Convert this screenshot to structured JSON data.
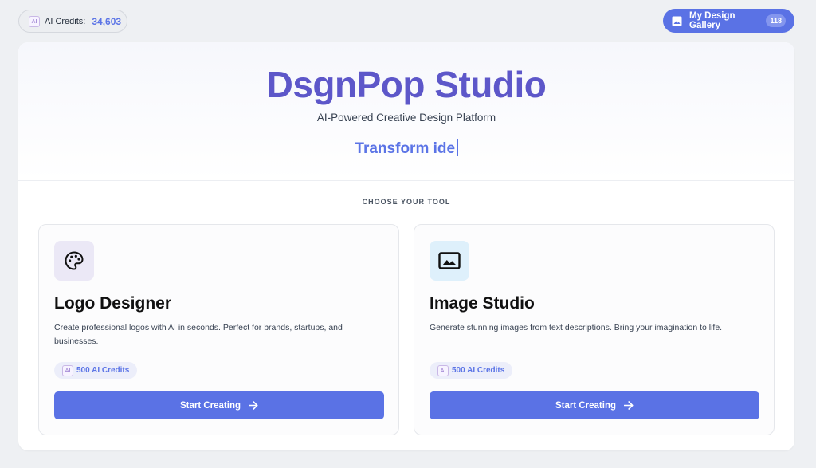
{
  "header": {
    "credits_chip": "AI",
    "credits_label": "AI Credits:",
    "credits_value": "34,603",
    "gallery_label": "My Design Gallery",
    "gallery_count": "118"
  },
  "hero": {
    "title": "DsgnPop Studio",
    "subtitle": "AI-Powered Creative Design Platform",
    "typing_text": "Transform ide"
  },
  "section_label": "CHOOSE YOUR TOOL",
  "tools": [
    {
      "title": "Logo Designer",
      "description": "Create professional logos with AI in seconds. Perfect for brands, startups, and businesses.",
      "badge_chip": "AI",
      "badge": "500 AI Credits",
      "button": "Start Creating",
      "icon": "palette-icon"
    },
    {
      "title": "Image Studio",
      "description": "Generate stunning images from text descriptions. Bring your imagination to life.",
      "badge_chip": "AI",
      "badge": "500 AI Credits",
      "button": "Start Creating",
      "icon": "image-icon"
    }
  ],
  "colors": {
    "accent": "#5a72e5",
    "title": "#5d57c9",
    "background": "#eef0f3"
  }
}
